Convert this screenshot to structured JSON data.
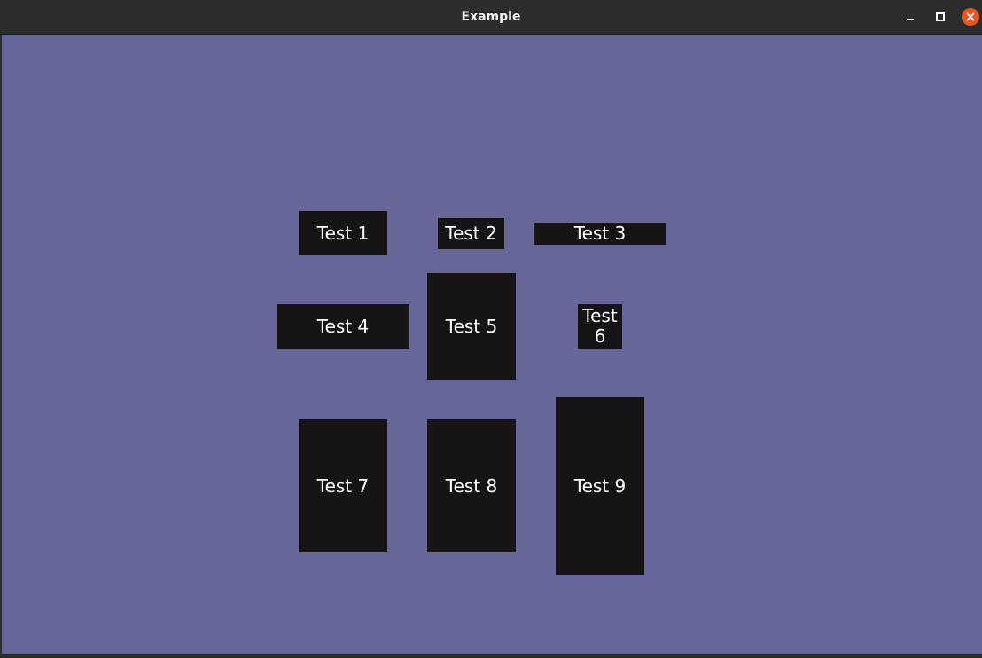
{
  "window": {
    "title": "Example",
    "controls": {
      "minimize_icon": "minimize-icon",
      "maximize_icon": "maximize-icon",
      "close_icon": "close-icon"
    }
  },
  "colors": {
    "titlebar": "#2c2c2c",
    "background": "#676699",
    "button_bg": "#161416",
    "button_text": "#ffffff",
    "close_button": "#e95420"
  },
  "buttons": [
    {
      "label": "Test 1"
    },
    {
      "label": "Test 2"
    },
    {
      "label": "Test 3"
    },
    {
      "label": "Test 4"
    },
    {
      "label": "Test 5"
    },
    {
      "label": "Test 6"
    },
    {
      "label": "Test 7"
    },
    {
      "label": "Test 8"
    },
    {
      "label": "Test 9"
    }
  ]
}
